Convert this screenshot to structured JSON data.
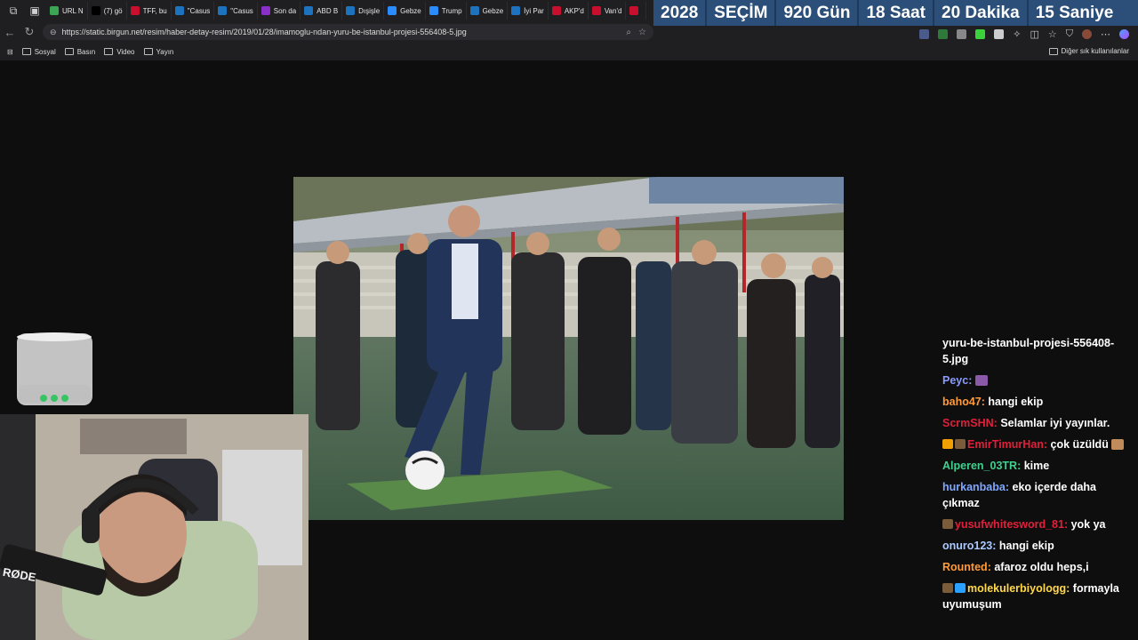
{
  "browser": {
    "tabs": [
      {
        "icon": "globe-icon",
        "color": "#3aa655",
        "label": "URL N"
      },
      {
        "icon": "x-icon",
        "color": "#000000",
        "label": "(7) gö"
      },
      {
        "icon": "news-icon",
        "color": "#c8102e",
        "label": "TFF, bu"
      },
      {
        "icon": "t24-icon",
        "color": "#1e73be",
        "label": "\"Casus"
      },
      {
        "icon": "t24-icon",
        "color": "#1e73be",
        "label": "\"Casus"
      },
      {
        "icon": "b-icon",
        "color": "#8b2fc9",
        "label": "Son da"
      },
      {
        "icon": "t24-icon",
        "color": "#1e73be",
        "label": "ABD B"
      },
      {
        "icon": "t24-icon",
        "color": "#1e73be",
        "label": "Dışişle"
      },
      {
        "icon": "circle-icon",
        "color": "#2a8cff",
        "label": "Gebze"
      },
      {
        "icon": "circle-icon",
        "color": "#2a8cff",
        "label": "Trump"
      },
      {
        "icon": "t24-icon",
        "color": "#1e73be",
        "label": "Gebze"
      },
      {
        "icon": "t24-icon",
        "color": "#1e73be",
        "label": "İyi Par"
      },
      {
        "icon": "b-icon",
        "color": "#c8102e",
        "label": "AKP'd"
      },
      {
        "icon": "news-icon",
        "color": "#c8102e",
        "label": "Van'd"
      },
      {
        "icon": "news-icon",
        "color": "#c8102e",
        "label": ""
      }
    ],
    "url": "https://static.birgun.net/resim/haber-detay-resim/2019/01/28/imamoglu-ndan-yuru-be-istanbul-projesi-556408-5.jpg",
    "bookmarks": [
      "Sosyal",
      "Basın",
      "Video",
      "Yayın"
    ],
    "other_bookmarks": "Diğer sık kullanılanlar"
  },
  "countdown": {
    "year": "2028",
    "label": "SEÇİM",
    "days": "920 Gün",
    "hours": "18 Saat",
    "minutes": "20 Dakika",
    "seconds": "15 Saniye"
  },
  "webcam": {
    "mic_brand": "RØDE"
  },
  "chat": {
    "header": "yuru-be-istanbul-projesi-556408-5.jpg",
    "messages": [
      {
        "user": "Peyc",
        "color": "#8a9cff",
        "text": "",
        "emote": "#8a5aa8"
      },
      {
        "user": "baho47",
        "color": "#ff9b3a",
        "text": "hangi ekip"
      },
      {
        "user": "ScrmSHN",
        "color": "#e0203a",
        "text": "Selamlar iyi yayınlar."
      },
      {
        "user": "EmirTimurHan",
        "color": "#e0203a",
        "text": "çok üzüldü",
        "badges": [
          "#f0a000",
          "#7a5b3a"
        ],
        "emote": "#c08a5a"
      },
      {
        "user": "Alperen_03TR",
        "color": "#3fd08f",
        "text": "kime"
      },
      {
        "user": "hurkanbaba",
        "color": "#7fa7ff",
        "text": "eko içerde daha çıkmaz"
      },
      {
        "user": "yusufwhitesword_81",
        "color": "#e0203a",
        "text": "yok ya",
        "badges": [
          "#7a5b3a"
        ]
      },
      {
        "user": "onuro123",
        "color": "#a9c9ff",
        "text": "hangi ekip"
      },
      {
        "user": "Rounted",
        "color": "#ff9b3a",
        "text": "afaroz oldu heps,i"
      },
      {
        "user": "molekulerbiyologg",
        "color": "#ffd84a",
        "text": "formayla uyumuşum",
        "badges": [
          "#7a5b3a",
          "#2aa0ff"
        ]
      }
    ]
  }
}
